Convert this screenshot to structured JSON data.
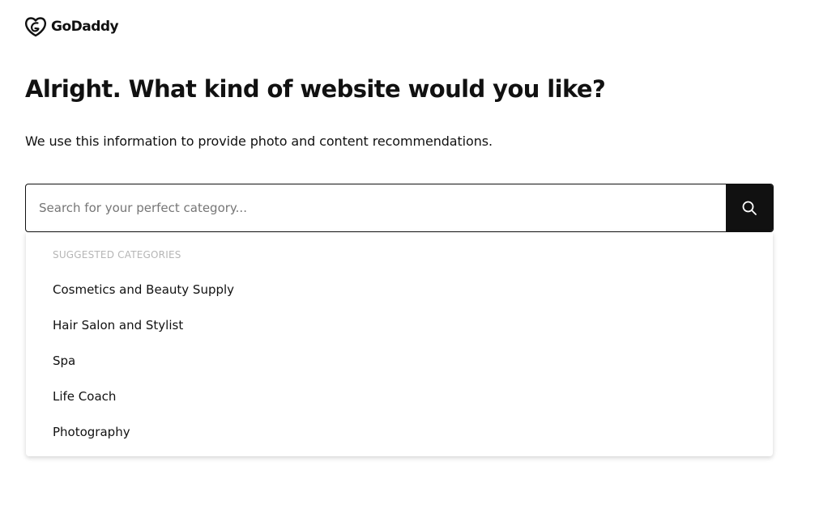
{
  "brand": {
    "name": "GoDaddy",
    "logo_icon": "godaddy-heart-logo-icon"
  },
  "page": {
    "title": "Alright. What kind of website would you like?",
    "subtitle": "We use this information to provide photo and content recommendations."
  },
  "search": {
    "placeholder": "Search for your perfect category...",
    "value": "",
    "button_icon": "search-icon"
  },
  "suggestions": {
    "heading": "SUGGESTED CATEGORIES",
    "items": [
      "Cosmetics and Beauty Supply",
      "Hair Salon and Stylist",
      "Spa",
      "Life Coach",
      "Photography"
    ]
  },
  "colors": {
    "text": "#111111",
    "button_background": "#111111",
    "muted_heading": "#b6b6b6",
    "placeholder": "#767676"
  }
}
